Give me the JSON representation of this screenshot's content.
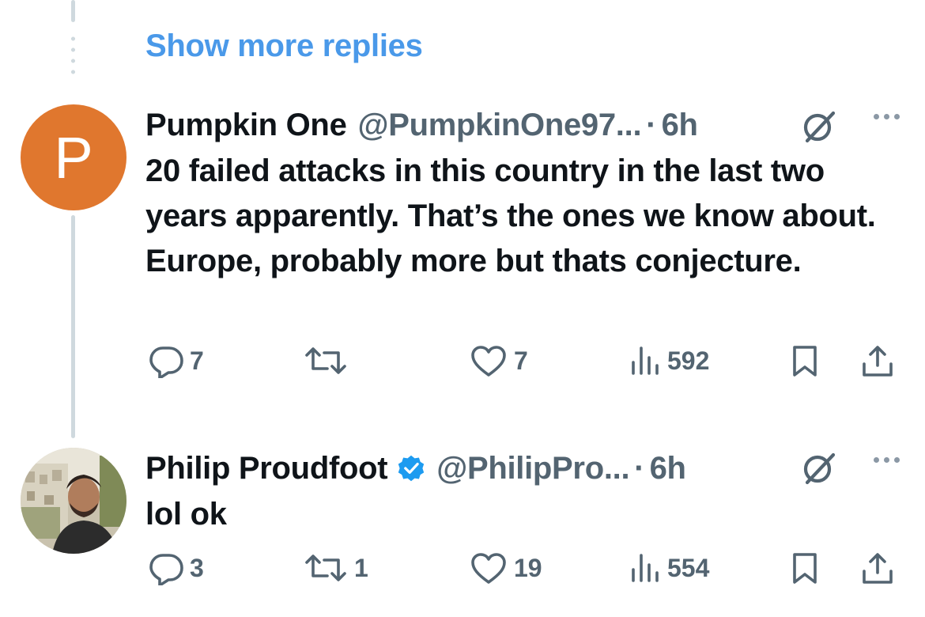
{
  "thread": {
    "show_more_label": "Show more replies"
  },
  "posts": [
    {
      "avatar_letter": "P",
      "avatar_color": "#e0772e",
      "name": "Pumpkin One",
      "handle": "@PumpkinOne97...",
      "separator": "·",
      "time": "6h",
      "verified": false,
      "text": "20 failed attacks in this country in the last two years apparently. That’s the ones we know about. Europe, probably more but thats conjecture.",
      "replies": "7",
      "reposts": "",
      "likes": "7",
      "views": "592"
    },
    {
      "avatar_letter": "",
      "name": "Philip Proudfoot",
      "handle": "@PhilipPro...",
      "separator": "·",
      "time": "6h",
      "verified": true,
      "text": "lol ok",
      "replies": "3",
      "reposts": "1",
      "likes": "19",
      "views": "554"
    }
  ],
  "colors": {
    "link": "#4a99e9",
    "text": "#0f1419",
    "muted": "#536471",
    "verified": "#1d9bf0",
    "thread_line": "#cfd9de"
  },
  "icons": {
    "reply": "reply-icon",
    "repost": "repost-icon",
    "like": "like-icon",
    "views": "views-icon",
    "bookmark": "bookmark-icon",
    "share": "share-icon",
    "grok": "grok-icon",
    "more": "more-icon",
    "verified": "verified-badge-icon"
  }
}
